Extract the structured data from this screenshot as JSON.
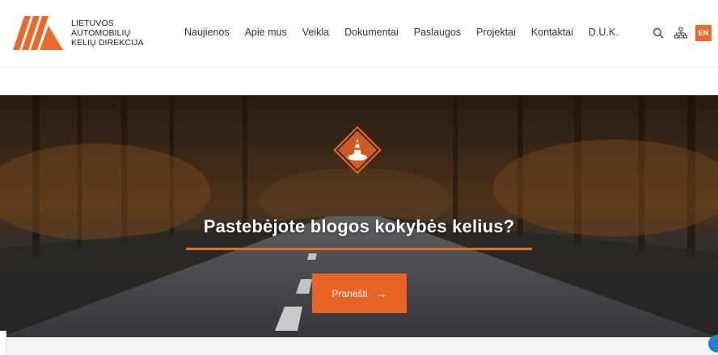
{
  "logo": {
    "line1": "LIETUVOS",
    "line2": "AUTOMOBILIŲ",
    "line3": "KELIŲ DIREKCIJA",
    "color": "#ea6a2b"
  },
  "nav": {
    "items": [
      {
        "label": "Naujienos"
      },
      {
        "label": "Apie mus"
      },
      {
        "label": "Veikla"
      },
      {
        "label": "Dokumentai"
      },
      {
        "label": "Paslaugos"
      },
      {
        "label": "Projektai"
      },
      {
        "label": "Kontaktai"
      },
      {
        "label": "D.U.K."
      }
    ]
  },
  "tools": {
    "search_icon": "search-icon",
    "sitemap_icon": "sitemap-icon",
    "lang_label": "EN"
  },
  "hero": {
    "title": "Pastebėjote blogos kokybės kelius?",
    "cta_label": "Pranešti",
    "cta_arrow": "→",
    "icon": "traffic-cone-icon",
    "accent": "#ea6a2b"
  }
}
